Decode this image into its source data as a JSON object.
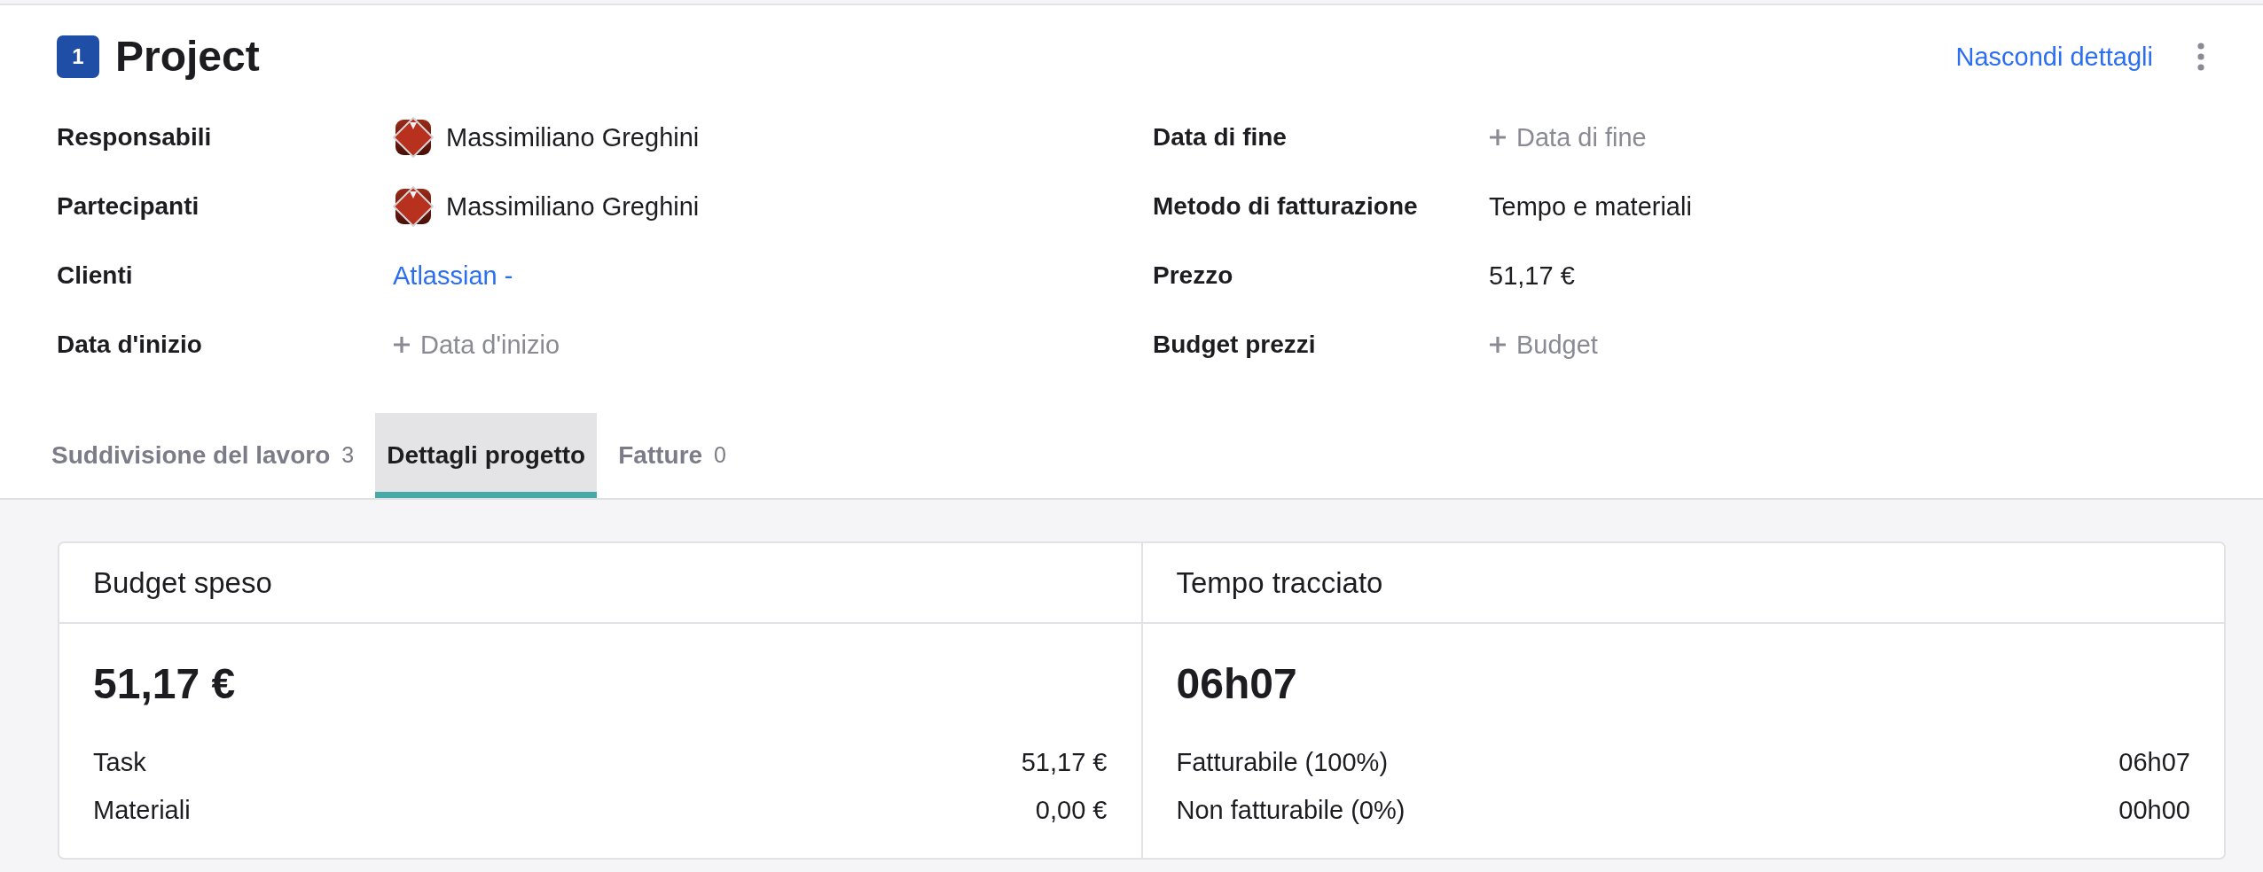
{
  "project": {
    "number": "1",
    "title": "Project",
    "hide_details_link": "Nascondi dettagli"
  },
  "details": {
    "left": [
      {
        "label": "Responsabili",
        "kind": "person",
        "value": "Massimiliano Greghini"
      },
      {
        "label": "Partecipanti",
        "kind": "person",
        "value": "Massimiliano Greghini"
      },
      {
        "label": "Clienti",
        "kind": "link",
        "value": "Atlassian -"
      },
      {
        "label": "Data d'inizio",
        "kind": "add",
        "value": "Data d'inizio"
      }
    ],
    "right": [
      {
        "label": "Data di fine",
        "kind": "add",
        "value": "Data di fine"
      },
      {
        "label": "Metodo di fatturazione",
        "kind": "text",
        "value": "Tempo e materiali"
      },
      {
        "label": "Prezzo",
        "kind": "text",
        "value": "51,17 €"
      },
      {
        "label": "Budget prezzi",
        "kind": "add",
        "value": "Budget"
      }
    ]
  },
  "tabs": [
    {
      "label": "Suddivisione del lavoro",
      "count": "3",
      "selected": false
    },
    {
      "label": "Dettagli progetto",
      "selected": true
    },
    {
      "label": "Fatture",
      "count": "0",
      "selected": false
    }
  ],
  "cards": [
    {
      "title": "Budget speso",
      "total": "51,17 €",
      "rows": [
        {
          "label": "Task",
          "value": "51,17 €"
        },
        {
          "label": "Materiali",
          "value": "0,00 €"
        }
      ]
    },
    {
      "title": "Tempo tracciato",
      "total": "06h07",
      "rows": [
        {
          "label": "Fatturabile (100%)",
          "value": "06h07"
        },
        {
          "label": "Non fatturabile (0%)",
          "value": "00h00"
        }
      ]
    }
  ]
}
